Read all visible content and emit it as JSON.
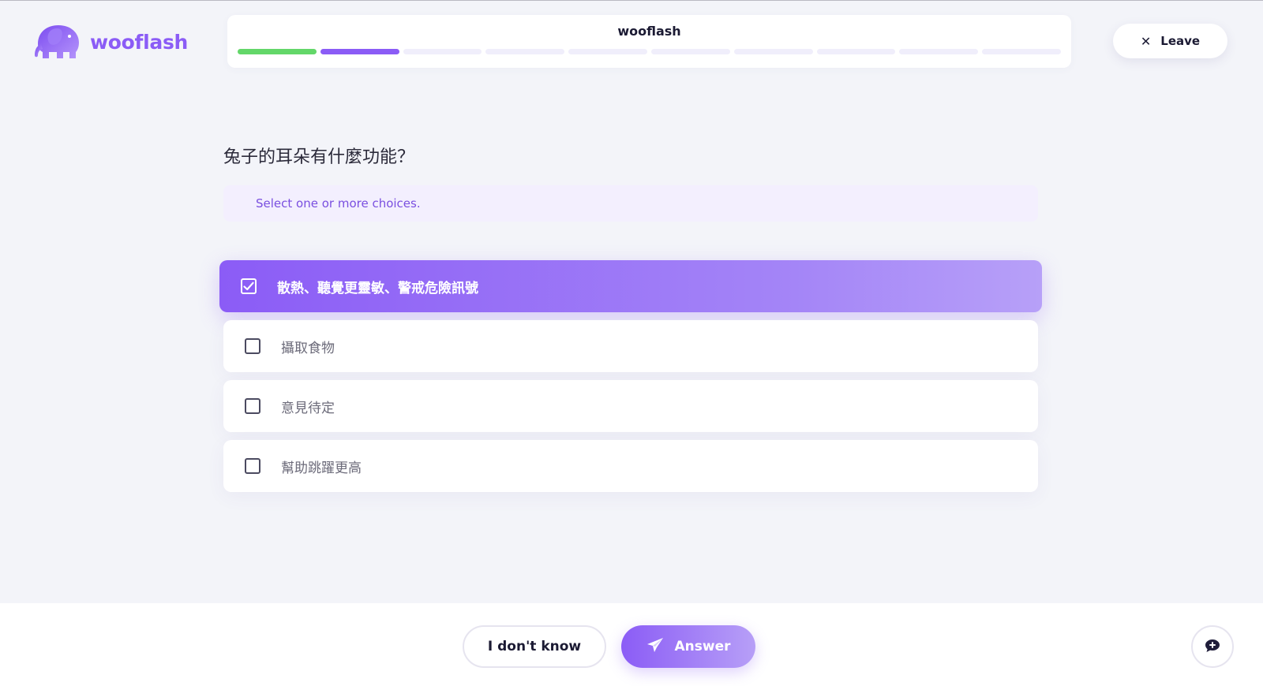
{
  "app": {
    "name": "wooflash"
  },
  "progress": {
    "title": "wooflash",
    "segments": [
      "done",
      "current",
      "pending",
      "pending",
      "pending",
      "pending",
      "pending",
      "pending",
      "pending",
      "pending"
    ]
  },
  "header": {
    "leave_label": "Leave"
  },
  "question": {
    "text": "兔子的耳朵有什麼功能？",
    "hint": "Select one or more choices.",
    "options": [
      {
        "label": "散熱、聽覺更靈敏、警戒危險訊號",
        "checked": true
      },
      {
        "label": "攝取食物",
        "checked": false
      },
      {
        "label": "意見待定",
        "checked": false
      },
      {
        "label": "幫助跳躍更高",
        "checked": false
      }
    ]
  },
  "footer": {
    "dont_know_label": "I don't know",
    "answer_label": "Answer"
  },
  "colors": {
    "accent": "#8b5cf6",
    "progress_done": "#63d769",
    "background": "#f3f4f9"
  },
  "icons": [
    "elephant-logo-icon",
    "close-icon",
    "checkbox-checked-icon",
    "checkbox-icon",
    "paper-plane-icon",
    "chat-add-icon"
  ]
}
